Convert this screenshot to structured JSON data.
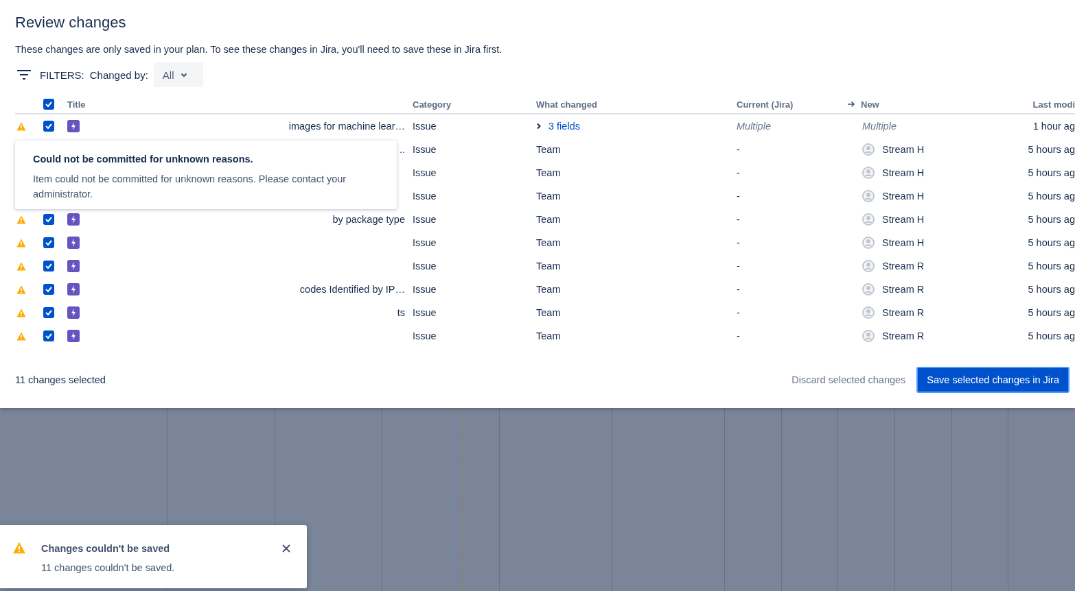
{
  "dialog": {
    "title": "Review changes",
    "description": "These changes are only saved in your plan. To see these changes in Jira, you'll need to save these in Jira first."
  },
  "filters": {
    "label": "FILTERS:",
    "changed_by_label": "Changed by:",
    "changed_by_value": "All"
  },
  "table": {
    "all_checked": true,
    "columns": [
      "Title",
      "Category",
      "What changed",
      "Current (Jira)",
      "New",
      "Last modi"
    ],
    "rows": [
      {
        "kind": "summary",
        "checked": true,
        "title": "images for machine lear…",
        "category": "Issue",
        "what_changed": "3 fields",
        "current": "Multiple",
        "new": "Multiple",
        "modified": "1 hour ag"
      },
      {
        "kind": "field",
        "title": "..",
        "category": "Issue",
        "what_changed": "Team",
        "current": "-",
        "new": "Stream H",
        "modified": "5 hours ag"
      },
      {
        "kind": "field",
        "category": "Issue",
        "what_changed": "Team",
        "current": "-",
        "new": "Stream H",
        "modified": "5 hours ag"
      },
      {
        "kind": "field",
        "category": "Issue",
        "what_changed": "Team",
        "current": "-",
        "new": "Stream H",
        "modified": "5 hours ag"
      },
      {
        "kind": "field",
        "checked": true,
        "title": "by package type",
        "category": "Issue",
        "what_changed": "Team",
        "current": "-",
        "new": "Stream H",
        "modified": "5 hours ag"
      },
      {
        "kind": "field",
        "checked": true,
        "category": "Issue",
        "what_changed": "Team",
        "current": "-",
        "new": "Stream H",
        "modified": "5 hours ag"
      },
      {
        "kind": "field",
        "checked": true,
        "category": "Issue",
        "what_changed": "Team",
        "current": "-",
        "new": "Stream R",
        "modified": "5 hours ag"
      },
      {
        "kind": "field",
        "checked": true,
        "title": "codes Identified by IP…",
        "category": "Issue",
        "what_changed": "Team",
        "current": "-",
        "new": "Stream R",
        "modified": "5 hours ag"
      },
      {
        "kind": "field",
        "checked": true,
        "title": "ts",
        "category": "Issue",
        "what_changed": "Team",
        "current": "-",
        "new": "Stream R",
        "modified": "5 hours ag"
      },
      {
        "kind": "field",
        "checked": true,
        "category": "Issue",
        "what_changed": "Team",
        "current": "-",
        "new": "Stream R",
        "modified": "5 hours ag"
      }
    ]
  },
  "popup": {
    "title": "Could not be committed for unknown reasons.",
    "body": "Item could not be committed for unknown reasons. Please contact your administrator."
  },
  "footer": {
    "selected_count": "11 changes selected",
    "discard": "Discard selected changes",
    "save": "Save selected changes in Jira"
  },
  "toast": {
    "title": "Changes couldn't be saved",
    "body": "11 changes couldn't be saved."
  }
}
